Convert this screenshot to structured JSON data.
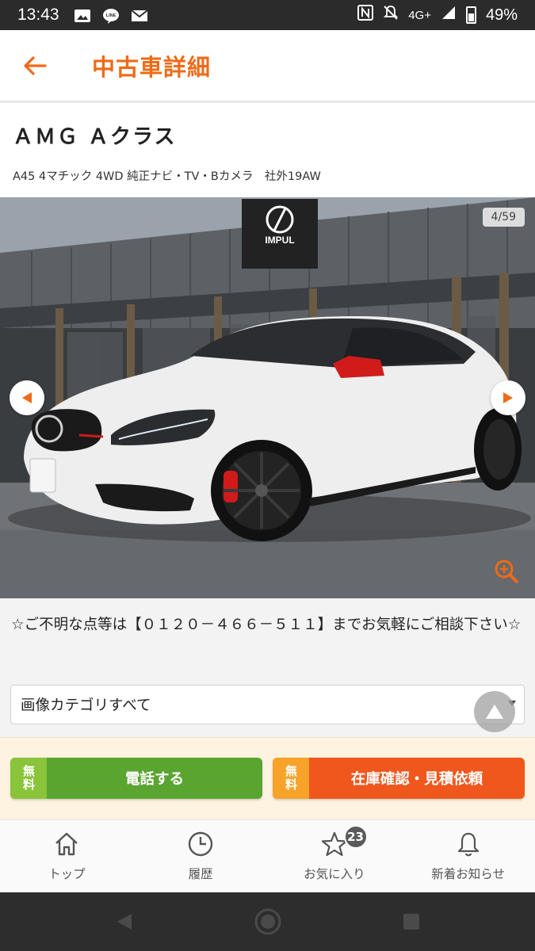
{
  "status_bar": {
    "time": "13:43",
    "network": "4G+",
    "battery": "49%",
    "icons": [
      "image-icon",
      "line-icon",
      "mail-icon",
      "nfc-icon",
      "mute-icon",
      "signal-icon",
      "battery-icon"
    ]
  },
  "header": {
    "title": "中古車詳細",
    "back_icon": "arrow-left-icon",
    "accent_color": "#ef6a16"
  },
  "car": {
    "name": "ＡＭＧ Ａクラス",
    "subtitle": "A45 4マチック 4WD 純正ナビ・TV・Bカメラ　社外19AW"
  },
  "gallery": {
    "counter": "4/59",
    "sign_text": "IMPUL",
    "prev_icon": "arrow-left-circle-icon",
    "next_icon": "arrow-right-circle-icon",
    "zoom_icon": "zoom-in-icon"
  },
  "notice": "☆ご不明な点等は【０１２０－４６６－５１１】までお気軽にご相談下さい☆",
  "category_select": {
    "selected": "画像カテゴリすべて"
  },
  "actions": {
    "call": {
      "free": "無料",
      "label": "電話する",
      "color": "#5aa530"
    },
    "inquiry": {
      "free": "無料",
      "label": "在庫確認・見積依頼",
      "color": "#f0571c"
    }
  },
  "tabs": [
    {
      "label": "トップ",
      "icon": "home-icon"
    },
    {
      "label": "履歴",
      "icon": "clock-icon"
    },
    {
      "label": "お気に入り",
      "icon": "star-icon",
      "badge": "23"
    },
    {
      "label": "新着お知らせ",
      "icon": "bell-icon"
    }
  ],
  "system_nav": [
    "back-triangle-icon",
    "home-circle-icon",
    "recents-square-icon"
  ]
}
